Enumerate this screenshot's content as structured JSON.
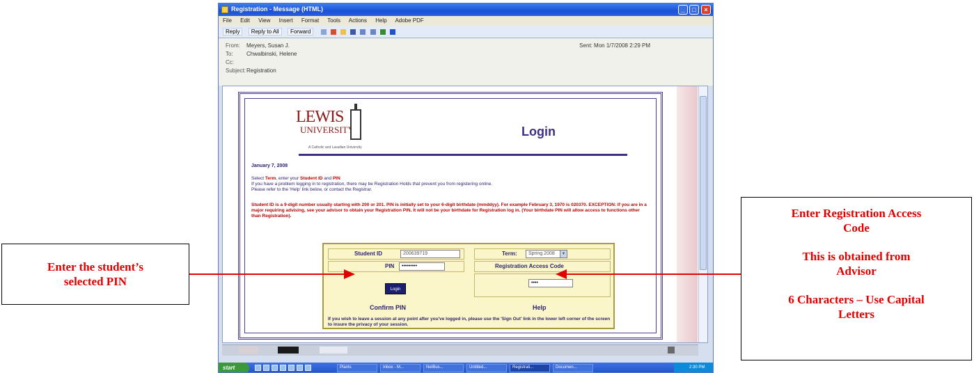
{
  "window": {
    "title": "Registration - Message (HTML)",
    "menu": [
      "File",
      "Edit",
      "View",
      "Insert",
      "Format",
      "Tools",
      "Actions",
      "Help",
      "Adobe PDF"
    ],
    "toolbar": [
      "Reply",
      "Reply to All",
      "Forward"
    ]
  },
  "email": {
    "from_label": "From:",
    "from": "Meyers, Susan J.",
    "to_label": "To:",
    "to": "Chwalbinski, Helene",
    "cc_label": "Cc:",
    "subject_label": "Subject:",
    "subject": "Registration",
    "sent": "Sent: Mon 1/7/2008 2:29 PM"
  },
  "page": {
    "logo_line1": "LEWIS",
    "logo_line2": "UNIVERSITY",
    "logo_sub": "A Catholic and Lasallian University",
    "title": "Login",
    "date": "January 7, 2008",
    "instr1_pre": "Select ",
    "instr1_term": "Term",
    "instr1_mid": ", enter your ",
    "instr1_id": "Student ID",
    "instr1_and": " and ",
    "instr1_pin": "PIN",
    "instr2": "If you have a problem logging in to registration, there may be Registration Holds that prevent you from registering online.",
    "instr3": "Please refer to the 'Help' link below, or contact the Registrar.",
    "note": "Student ID is a 9-digit number usually starting with 200 or 201. PIN is initially set to your 6-digit birthdate (mmddyy). For example February 3, 1970 is 020370. EXCEPTION: If you are in a major requiring advising, see your advisor to obtain your Registration PIN. It will not be your birthdate for Registration log in. (Your birthdate PIN will allow access to functions other than Registration).",
    "student_id_label": "Student ID",
    "student_id_value": "200639719",
    "pin_label": "PIN",
    "pin_value": "•••••••••",
    "login_button": "Login",
    "term_label": "Term:",
    "term_value": "Spring 2008",
    "rac_label": "Registration Access Code",
    "rac_value": "••••",
    "confirm_pin": "Confirm PIN",
    "help": "Help",
    "bottom_text": "If you wish to leave a session at any point after you've logged in, please use the 'Sign Out' link in the lower left corner of the screen to insure the privacy of your session."
  },
  "taskbar": {
    "start": "start",
    "items": [
      "Plants",
      "Inbox - M...",
      "NetBus...",
      "Untitled...",
      "Registrati...",
      "Documen..."
    ],
    "clock": "2:30 PM"
  },
  "callouts": {
    "left_line1": "Enter the student’s",
    "left_line2": "selected PIN",
    "right_line1": "Enter Registration Access",
    "right_line2": "Code",
    "right_line3": "This is obtained from",
    "right_line4": "Advisor",
    "right_line5": "6 Characters – Use Capital",
    "right_line6": "Letters"
  },
  "colors": {
    "callout_text": "#e00000",
    "arrow": "#e00000",
    "page_title": "#3d2f86",
    "login_box": "#fbf6c9"
  }
}
